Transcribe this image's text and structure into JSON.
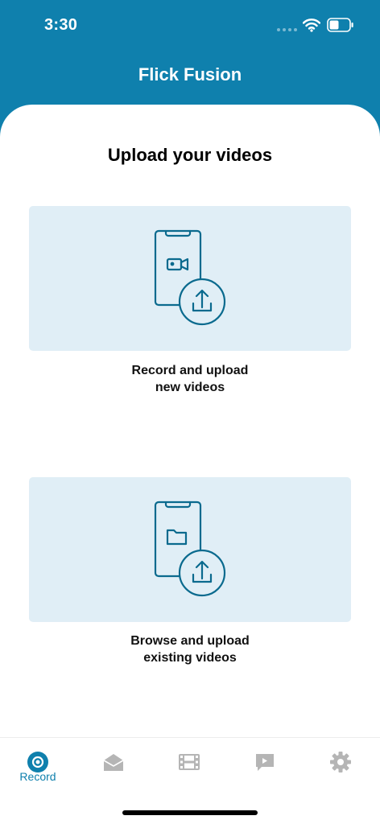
{
  "status_bar": {
    "time": "3:30"
  },
  "header": {
    "title": "Flick Fusion"
  },
  "main": {
    "heading": "Upload your videos",
    "cards": [
      {
        "label": "Record and upload\nnew videos",
        "icon": "phone-video-upload-icon"
      },
      {
        "label": "Browse and upload\nexisting videos",
        "icon": "phone-folder-upload-icon"
      }
    ]
  },
  "tabbar": {
    "tabs": [
      {
        "label": "Record",
        "icon": "record-icon",
        "active": true
      },
      {
        "label": "",
        "icon": "inbox-icon",
        "active": false
      },
      {
        "label": "",
        "icon": "film-icon",
        "active": false
      },
      {
        "label": "",
        "icon": "chat-icon",
        "active": false
      },
      {
        "label": "",
        "icon": "gear-icon",
        "active": false
      }
    ]
  },
  "colors": {
    "brand": "#0f80ad",
    "card_bg": "#e0eef6",
    "icon_stroke": "#0a6a8e",
    "inactive_icon": "#b5b5b5"
  }
}
